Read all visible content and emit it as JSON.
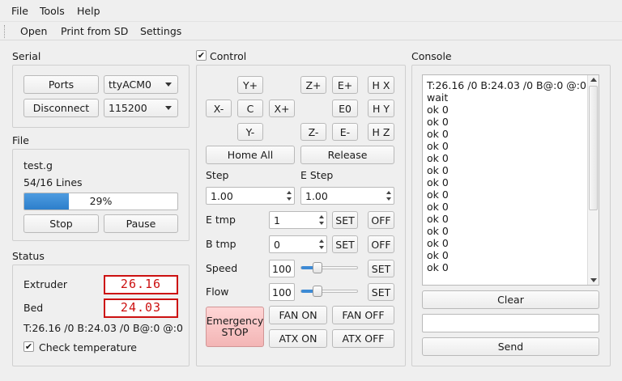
{
  "menu": {
    "file": "File",
    "tools": "Tools",
    "help": "Help"
  },
  "toolbar": {
    "open": "Open",
    "print_sd": "Print from SD",
    "settings": "Settings"
  },
  "serial": {
    "title": "Serial",
    "ports_label": "Ports",
    "port_value": "ttyACM0",
    "disconnect_label": "Disconnect",
    "baud_value": "115200"
  },
  "file": {
    "title": "File",
    "name": "test.g",
    "lines": "54/16 Lines",
    "progress_percent": 29,
    "progress_text": "29%",
    "stop_label": "Stop",
    "pause_label": "Pause"
  },
  "status": {
    "title": "Status",
    "extruder_label": "Extruder",
    "extruder_value": "26.16",
    "bed_label": "Bed",
    "bed_value": "24.03",
    "temp_line": "T:26.16 /0 B:24.03 /0 B@:0 @:0",
    "check_temp_label": "Check temperature",
    "check_temp_checked": true,
    "lcd_color": "#cc1010"
  },
  "control": {
    "title": "Control",
    "enabled": true,
    "jog": {
      "y_plus": "Y+",
      "z_plus": "Z+",
      "e_plus": "E+",
      "home_x": "H X",
      "x_minus": "X-",
      "center": "C",
      "x_plus": "X+",
      "e_zero": "E0",
      "home_y": "H Y",
      "y_minus": "Y-",
      "z_minus": "Z-",
      "e_minus": "E-",
      "home_z": "H Z"
    },
    "home_all": "Home All",
    "release": "Release",
    "step_label": "Step",
    "step_value": "1.00",
    "estep_label": "E Step",
    "estep_value": "1.00",
    "etmp_label": "E tmp",
    "etmp_value": "1",
    "btmp_label": "B tmp",
    "btmp_value": "0",
    "set_label": "SET",
    "off_label": "OFF",
    "speed_label": "Speed",
    "speed_value": "100",
    "speed_slider_fraction": 0.25,
    "flow_label": "Flow",
    "flow_value": "100",
    "flow_slider_fraction": 0.25,
    "estop_line1": "Emergency",
    "estop_line2": "STOP",
    "fan_on": "FAN ON",
    "fan_off": "FAN OFF",
    "atx_on": "ATX ON",
    "atx_off": "ATX OFF",
    "accent_color": "#3c8ad5"
  },
  "console": {
    "title": "Console",
    "lines": [
      "T:26.16 /0 B:24.03 /0 B@:0 @:0",
      "wait",
      "ok 0",
      "ok 0",
      "ok 0",
      "ok 0",
      "ok 0",
      "ok 0",
      "ok 0",
      "ok 0",
      "ok 0",
      "ok 0",
      "ok 0",
      "ok 0",
      "ok 0",
      "ok 0"
    ],
    "clear_label": "Clear",
    "input_value": "",
    "send_label": "Send"
  }
}
